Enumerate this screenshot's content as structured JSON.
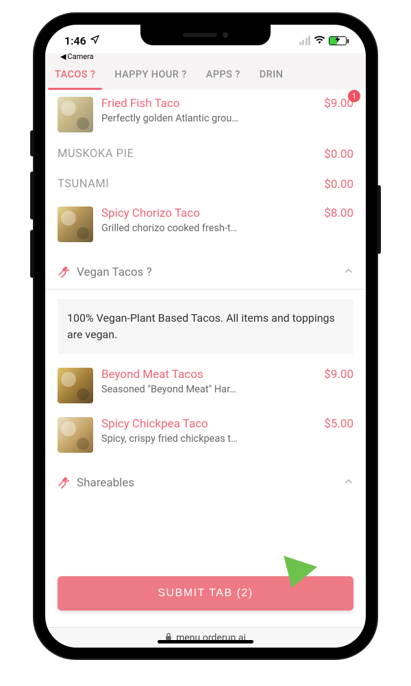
{
  "status": {
    "time": "1:46",
    "back_label": "Camera"
  },
  "tabs": [
    {
      "label": "TACOS ?",
      "active": true
    },
    {
      "label": "HAPPY HOUR ?",
      "active": false
    },
    {
      "label": "APPS ?",
      "active": false
    },
    {
      "label": "DRIN",
      "active": false
    }
  ],
  "items_top": [
    {
      "name": "Fried Fish Taco",
      "desc": "Perfectly golden Atlantic grou…",
      "price": "$9.00",
      "qty": "1",
      "thumb": "fish"
    },
    {
      "name": "MUSKOKA PIE",
      "desc": "",
      "price": "$0.00",
      "plain": true
    },
    {
      "name": "TSUNAMI",
      "desc": "",
      "price": "$0.00",
      "plain": true
    },
    {
      "name": "Spicy Chorizo Taco",
      "desc": "Grilled chorizo cooked fresh-t…",
      "price": "$8.00",
      "thumb": "chorizo"
    }
  ],
  "section_vegan": {
    "title": "Vegan Tacos ?",
    "desc": "100% Vegan-Plant Based Tacos. All items and toppings are vegan."
  },
  "items_vegan": [
    {
      "name": "Beyond Meat Tacos",
      "desc": "Seasoned \"Beyond Meat\" Har…",
      "price": "$9.00",
      "thumb": "beyond"
    },
    {
      "name": "Spicy Chickpea Taco",
      "desc": "Spicy, crispy fried chickpeas t…",
      "price": "$5.00",
      "thumb": "chickpea"
    }
  ],
  "section_shareables": {
    "title": "Shareables"
  },
  "submit": {
    "label": "SUBMIT TAB (2)"
  },
  "url": "menu.orderup.ai"
}
